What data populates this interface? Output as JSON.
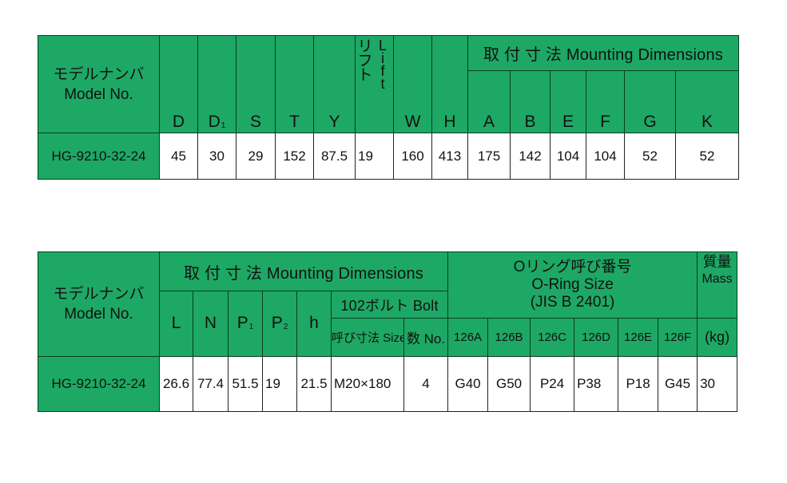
{
  "model_header": {
    "jp": "モデルナンバ",
    "en": "Model No."
  },
  "table1": {
    "headers": {
      "D": "D",
      "D1_main": "D",
      "D1_sub": "1",
      "S": "S",
      "T": "T",
      "Y": "Y",
      "lift_jp": [
        "リ",
        "フ",
        "ト"
      ],
      "lift_en": [
        "L",
        "i",
        "f",
        "t"
      ],
      "W": "W",
      "H": "H",
      "mounting_group": "取 付 寸 法 Mounting Dimensions",
      "A": "A",
      "B": "B",
      "E": "E",
      "F": "F",
      "G": "G",
      "K": "K"
    },
    "row": {
      "model": "HG-9210-32-24",
      "D": "45",
      "D1": "30",
      "S": "29",
      "T": "152",
      "Y": "87.5",
      "lift": "19",
      "W": "160",
      "H": "413",
      "A": "175",
      "B": "142",
      "E": "104",
      "F": "104",
      "G": "52",
      "K": "52"
    }
  },
  "table2": {
    "headers": {
      "mounting_group": "取 付 寸 法 Mounting Dimensions",
      "L": "L",
      "N": "N",
      "P1_main": "P",
      "P1_sub": "1",
      "P2_main": "P",
      "P2_sub": "2",
      "h": "h",
      "bolt_group": "102ボルト Bolt",
      "bolt_size": "呼び寸法 Size",
      "bolt_no": "数 No.",
      "oring_jp": "Oリング呼び番号",
      "oring_en": "O-Ring Size",
      "oring_jis": "(JIS B 2401)",
      "o126A": "126A",
      "o126B": "126B",
      "o126C": "126C",
      "o126D": "126D",
      "o126E": "126E",
      "o126F": "126F",
      "mass_jp": "質量",
      "mass_en": "Mass",
      "mass_unit": "(kg)"
    },
    "row": {
      "model": "HG-9210-32-24",
      "L": "26.6",
      "N": "77.4",
      "P1": "51.5",
      "P2": "19",
      "h": "21.5",
      "size": "M20×180",
      "no": "4",
      "o126A": "G40",
      "o126B": "G50",
      "o126C": "P24",
      "o126D": "P38",
      "o126E": "P18",
      "o126F": "G45",
      "mass": "30"
    }
  }
}
